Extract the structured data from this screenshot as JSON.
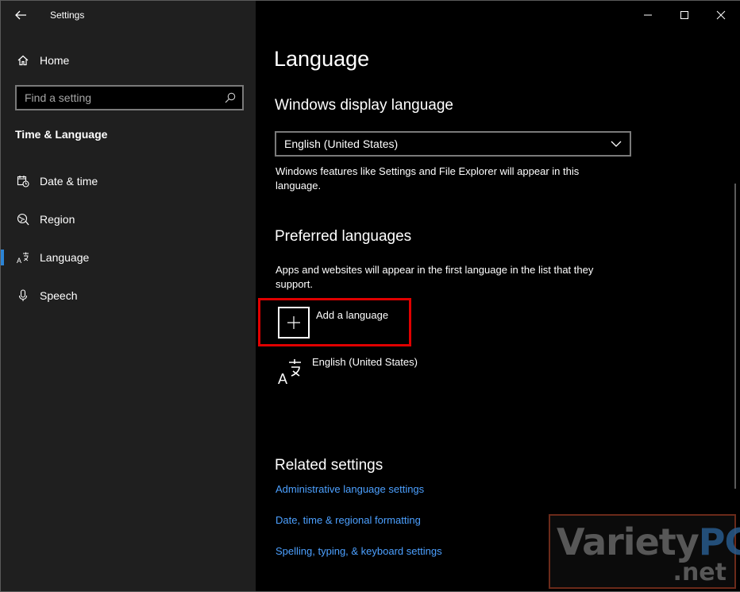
{
  "window": {
    "title": "Settings"
  },
  "sidebar": {
    "home_label": "Home",
    "search": {
      "placeholder": "Find a setting",
      "value": ""
    },
    "section_title": "Time & Language",
    "items": [
      {
        "label": "Date & time",
        "icon": "calendar-clock-icon"
      },
      {
        "label": "Region",
        "icon": "globe-region-icon"
      },
      {
        "label": "Language",
        "icon": "language-icon",
        "active": true
      },
      {
        "label": "Speech",
        "icon": "microphone-icon"
      }
    ]
  },
  "main": {
    "title": "Language",
    "display_language": {
      "heading": "Windows display language",
      "selected": "English (United States)",
      "description": "Windows features like Settings and File Explorer will appear in this language."
    },
    "preferred": {
      "heading": "Preferred languages",
      "description": "Apps and websites will appear in the first language in the list that they support.",
      "add_label": "Add a language",
      "languages": [
        {
          "label": "English (United States)"
        }
      ]
    },
    "related": {
      "heading": "Related settings",
      "links": [
        "Administrative language settings",
        "Date, time & regional formatting",
        "Spelling, typing, & keyboard settings"
      ]
    }
  },
  "watermark": {
    "main": "Variety",
    "accent": "PC",
    "sub": ".net"
  },
  "colors": {
    "accent": "#2b84d6",
    "link": "#4ca0ff",
    "highlight_border": "#e00000",
    "sidebar_bg": "#1f1f1f"
  }
}
